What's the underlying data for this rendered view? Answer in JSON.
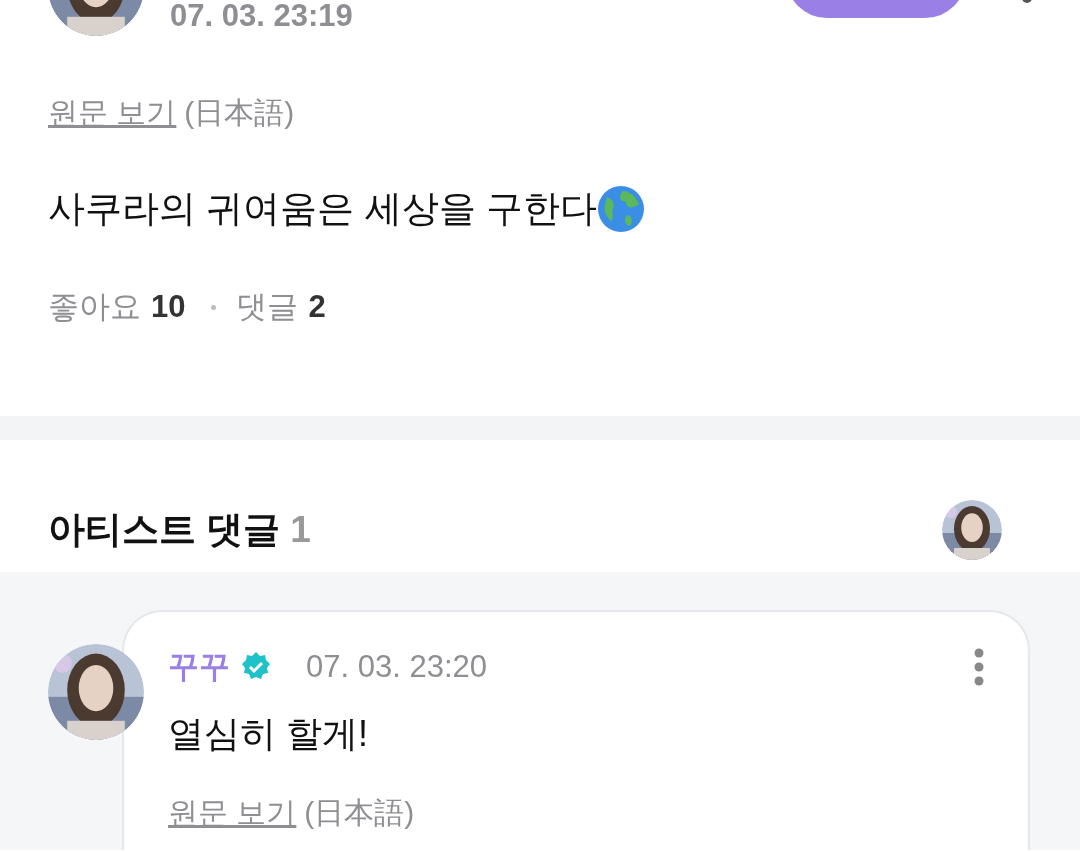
{
  "post": {
    "time": "07. 03. 23:19",
    "original_link": "원문 보기",
    "language": "(日本語)",
    "text": "사쿠라의 귀여움은 세상을 구한다",
    "stats": [
      {
        "label": "좋아요",
        "count": "10"
      },
      {
        "label": "댓글",
        "count": "2"
      }
    ]
  },
  "artist_comments": {
    "title": "아티스트 댓글",
    "count": "1",
    "comments": [
      {
        "author": "꾸꾸",
        "verified": true,
        "time": "07. 03. 23:20",
        "text": "열심히 할게!",
        "original_link": "원문 보기",
        "language": "(日本語)"
      }
    ]
  }
}
